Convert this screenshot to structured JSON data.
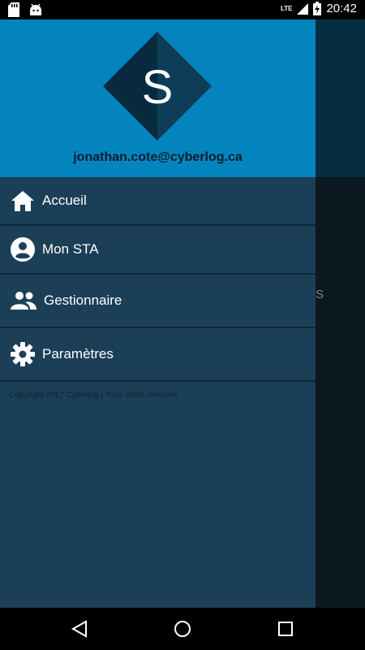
{
  "status_bar": {
    "time": "20:42",
    "network": "LTE"
  },
  "background": {
    "partial_text": "S"
  },
  "drawer": {
    "logo_letter": "S",
    "email": "jonathan.cote@cyberlog.ca",
    "menu": [
      {
        "label": "Accueil",
        "icon": "home-icon"
      },
      {
        "label": "Mon STA",
        "icon": "account-circle-icon"
      },
      {
        "label": "Gestionnaire",
        "icon": "people-icon"
      },
      {
        "label": "Paramètres",
        "icon": "gear-icon"
      }
    ],
    "copyright": "Copyright 2017 Cyberlog | Tous droits réservés"
  },
  "colors": {
    "header": "#0384bf",
    "drawer": "#1b3f56",
    "divider": "#0d2736"
  }
}
